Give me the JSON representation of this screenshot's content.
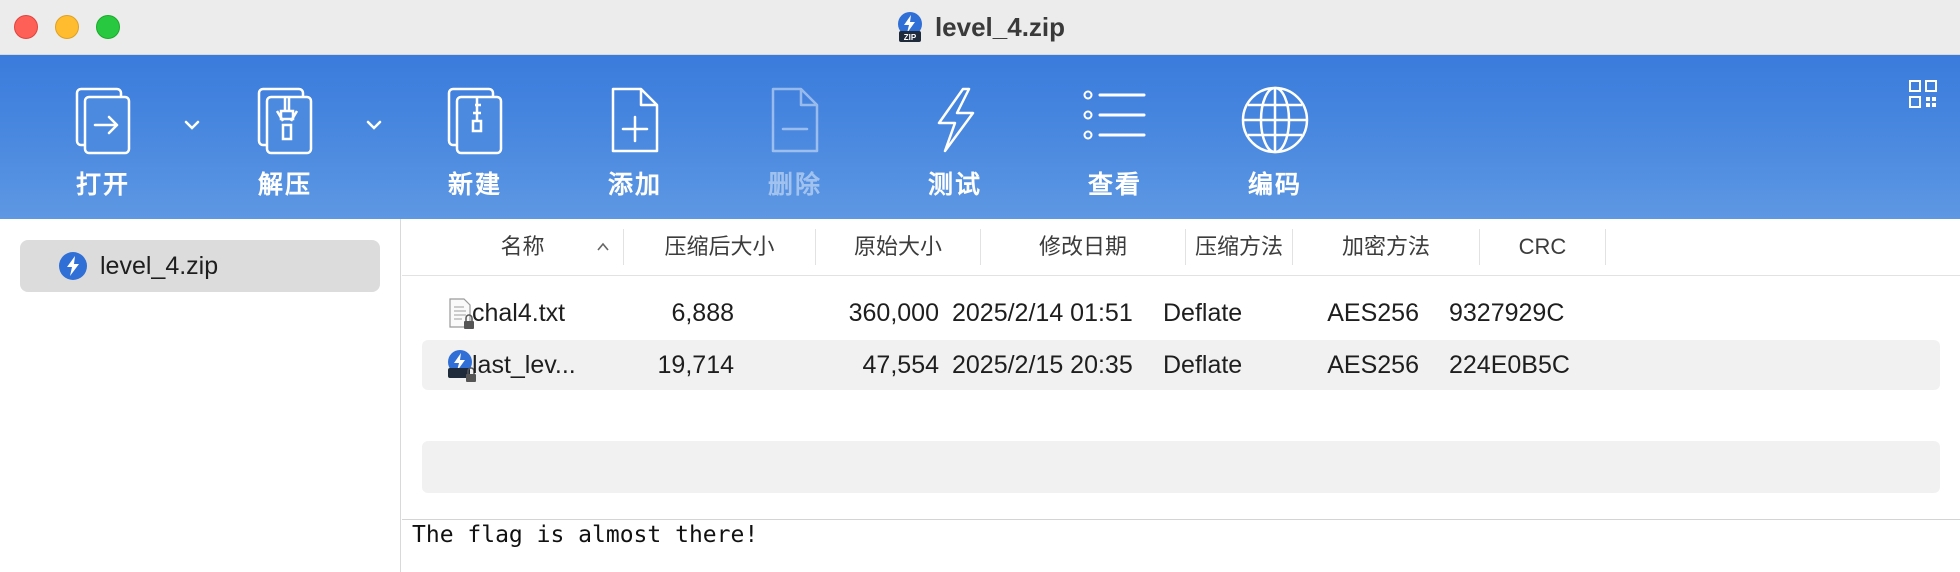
{
  "window": {
    "title": "level_4.zip",
    "zip_badge_text": "ZIP"
  },
  "toolbar": {
    "items": [
      {
        "label": "打开",
        "icon": "open-icon"
      },
      {
        "label": "解压",
        "icon": "extract-icon"
      },
      {
        "label": "新建",
        "icon": "new-archive-icon"
      },
      {
        "label": "添加",
        "icon": "add-file-icon"
      },
      {
        "label": "删除",
        "icon": "delete-file-icon",
        "disabled": true
      },
      {
        "label": "测试",
        "icon": "lightning-icon"
      },
      {
        "label": "查看",
        "icon": "list-view-icon"
      },
      {
        "label": "编码",
        "icon": "globe-icon"
      }
    ],
    "accent": "#3a7bdc"
  },
  "sidebar": {
    "items": [
      {
        "label": "level_4.zip",
        "icon": "zip-archive-icon",
        "selected": true
      }
    ]
  },
  "table": {
    "columns": [
      "名称",
      "压缩后大小",
      "原始大小",
      "修改日期",
      "压缩方法",
      "加密方法",
      "CRC"
    ],
    "rows": [
      {
        "name": "chal4.txt",
        "compressed": "6,888",
        "original": "360,000",
        "modified": "2025/2/14 01:51",
        "method": "Deflate",
        "encryption": "AES256",
        "crc": "9327929C",
        "icon": "locked-text-file-icon"
      },
      {
        "name": "last_lev...",
        "compressed": "19,714",
        "original": "47,554",
        "modified": "2025/2/15 20:35",
        "method": "Deflate",
        "encryption": "AES256",
        "crc": "224E0B5C",
        "icon": "locked-zip-file-icon"
      }
    ]
  },
  "comment": {
    "text": "The flag is almost there!"
  }
}
